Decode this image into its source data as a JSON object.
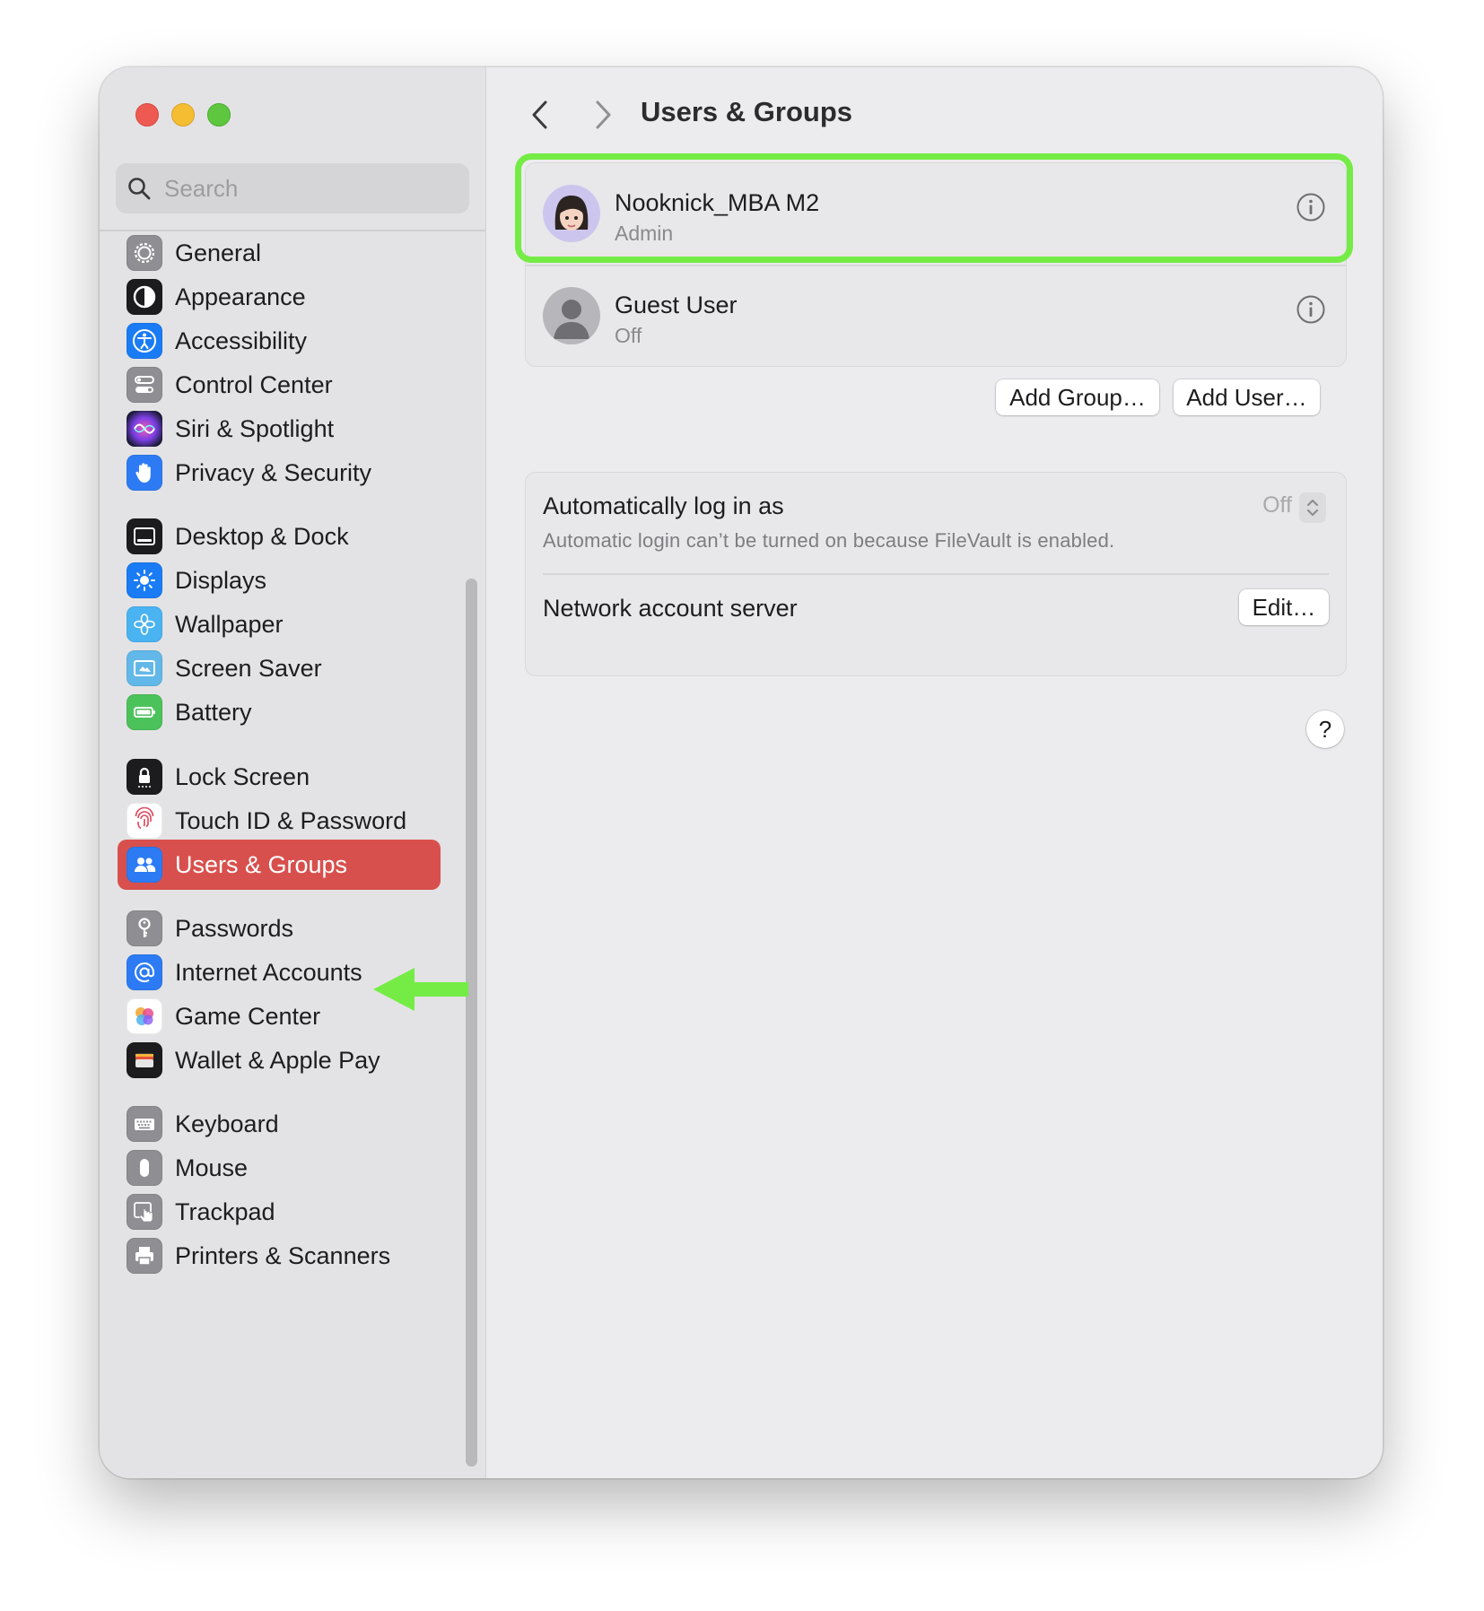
{
  "window": {
    "title": "Users & Groups"
  },
  "search": {
    "placeholder": "Search"
  },
  "sidebar": {
    "items": [
      {
        "label": "General",
        "icon": "gear-icon",
        "color": "#8e8e93"
      },
      {
        "label": "Appearance",
        "icon": "appearance-icon",
        "color": "#1c1c1e"
      },
      {
        "label": "Accessibility",
        "icon": "accessibility-icon",
        "color": "#1a7cf5"
      },
      {
        "label": "Control Center",
        "icon": "control-center-icon",
        "color": "#8e8e93"
      },
      {
        "label": "Siri & Spotlight",
        "icon": "siri-icon",
        "color": "#3a2a6b"
      },
      {
        "label": "Privacy & Security",
        "icon": "hand-icon",
        "color": "#2d7bf4"
      },
      {
        "label": "Desktop & Dock",
        "icon": "dock-icon",
        "color": "#1c1c1e"
      },
      {
        "label": "Displays",
        "icon": "sun-icon",
        "color": "#1a7cf5"
      },
      {
        "label": "Wallpaper",
        "icon": "flower-icon",
        "color": "#4ab3f2"
      },
      {
        "label": "Screen Saver",
        "icon": "screen-saver-icon",
        "color": "#62b8e8"
      },
      {
        "label": "Battery",
        "icon": "battery-icon",
        "color": "#4cc25a"
      },
      {
        "label": "Lock Screen",
        "icon": "lock-icon",
        "color": "#1c1c1e"
      },
      {
        "label": "Touch ID & Password",
        "icon": "fingerprint-icon",
        "color": "#ffffff"
      },
      {
        "label": "Users & Groups",
        "icon": "users-icon",
        "color": "#2d7bf4",
        "selected": true
      },
      {
        "label": "Passwords",
        "icon": "key-icon",
        "color": "#8e8e93"
      },
      {
        "label": "Internet Accounts",
        "icon": "at-sign-icon",
        "color": "#2d7bf4"
      },
      {
        "label": "Game Center",
        "icon": "game-center-icon",
        "color": "#ffffff"
      },
      {
        "label": "Wallet & Apple Pay",
        "icon": "wallet-icon",
        "color": "#1c1c1e"
      },
      {
        "label": "Keyboard",
        "icon": "keyboard-icon",
        "color": "#8e8e93"
      },
      {
        "label": "Mouse",
        "icon": "mouse-icon",
        "color": "#8e8e93"
      },
      {
        "label": "Trackpad",
        "icon": "trackpad-icon",
        "color": "#8e8e93"
      },
      {
        "label": "Printers & Scanners",
        "icon": "printer-icon",
        "color": "#8e8e93"
      }
    ]
  },
  "users": [
    {
      "name": "Nooknick_MBA M2",
      "role": "Admin"
    },
    {
      "name": "Guest User",
      "role": "Off"
    }
  ],
  "buttons": {
    "add_group": "Add Group…",
    "add_user": "Add User…",
    "edit": "Edit…",
    "help": "?"
  },
  "auto_login": {
    "label": "Automatically log in as",
    "value": "Off",
    "description": "Automatic login can’t be turned on because FileVault is enabled."
  },
  "network": {
    "label": "Network account server"
  },
  "colors": {
    "selection": "#d8504d",
    "highlight": "#74ec45",
    "accent": "#2d7bf4"
  }
}
